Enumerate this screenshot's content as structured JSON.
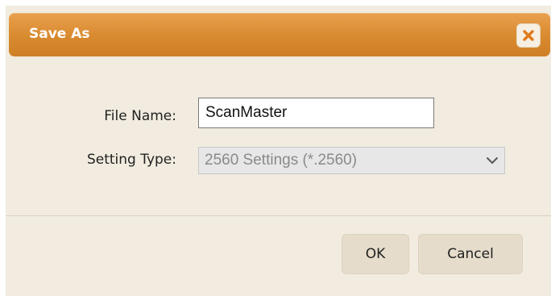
{
  "dialog": {
    "title": "Save As",
    "close_icon": "close-icon",
    "accent_color": "#d88a2f"
  },
  "form": {
    "file_name_label": "File Name:",
    "file_name_value": "ScanMaster",
    "setting_type_label": "Setting Type:",
    "setting_type_selected": "2560 Settings (*.2560)",
    "select_icon": "chevron-down-icon"
  },
  "buttons": {
    "ok_label": "OK",
    "cancel_label": "Cancel"
  }
}
